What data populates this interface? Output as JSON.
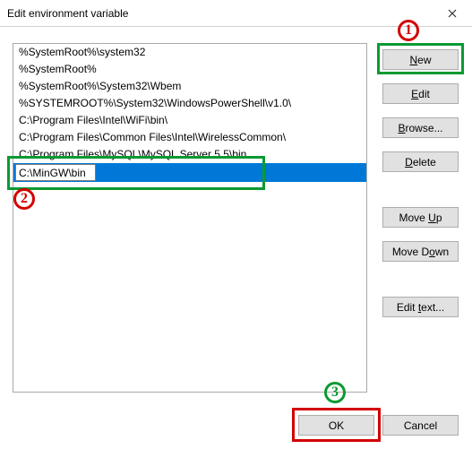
{
  "window": {
    "title": "Edit environment variable"
  },
  "list": {
    "items": [
      "%SystemRoot%\\system32",
      "%SystemRoot%",
      "%SystemRoot%\\System32\\Wbem",
      "%SYSTEMROOT%\\System32\\WindowsPowerShell\\v1.0\\",
      "C:\\Program Files\\Intel\\WiFi\\bin\\",
      "C:\\Program Files\\Common Files\\Intel\\WirelessCommon\\",
      "C:\\Program Files\\MySQL\\MySQL Server 5.5\\bin"
    ],
    "editing_value": "C:\\MinGW\\bin"
  },
  "buttons": {
    "new": "New",
    "edit": "Edit",
    "browse": "Browse...",
    "delete": "Delete",
    "move_up": "Move Up",
    "move_down": "Move Down",
    "edit_text": "Edit text...",
    "ok": "OK",
    "cancel": "Cancel"
  },
  "annotations": {
    "n1": "1",
    "n2": "2",
    "n3": "3"
  }
}
